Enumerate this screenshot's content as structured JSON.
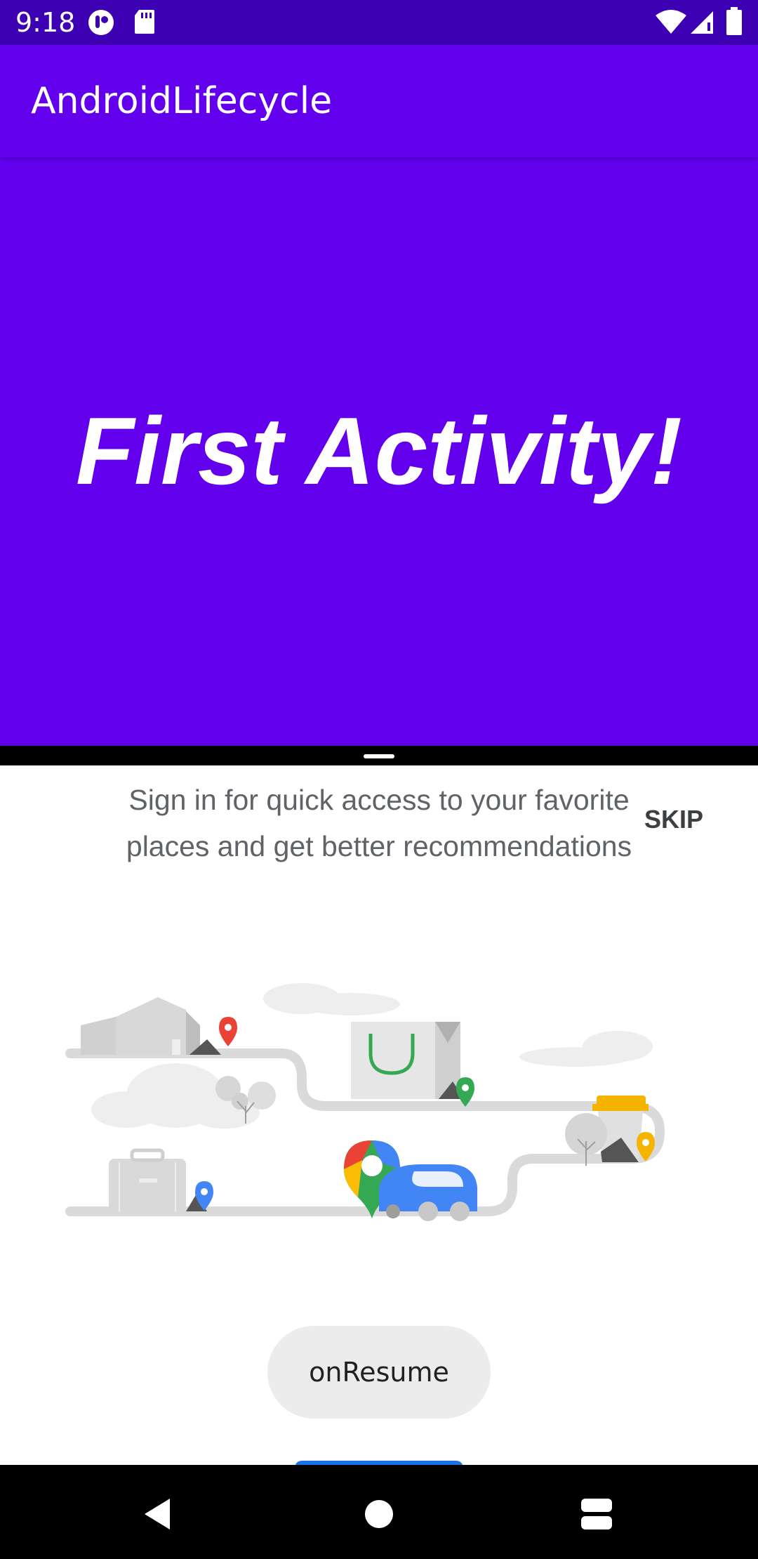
{
  "status_bar": {
    "time": "9:18",
    "background": "#3e00b3",
    "icons": [
      "app-notification-icon",
      "sd-card-icon",
      "wifi-icon",
      "cell-signal-icon",
      "battery-icon"
    ]
  },
  "app_bar": {
    "title": "AndroidLifecycle",
    "background": "#6200ee"
  },
  "main": {
    "heading": "First Activity!",
    "background": "#6200ee"
  },
  "bottom_panel": {
    "signin_message": "Sign in for quick access to your favorite places and get better recommendations",
    "skip_label": "SKIP",
    "illustration_icons": [
      "house-icon",
      "shopping-bag-icon",
      "coffee-cup-icon",
      "suitcase-icon",
      "maps-pin-icon",
      "car-icon"
    ]
  },
  "toast": {
    "text": "onResume"
  },
  "nav_bar": {
    "icons": [
      "back-icon",
      "home-icon",
      "recents-icon"
    ]
  }
}
